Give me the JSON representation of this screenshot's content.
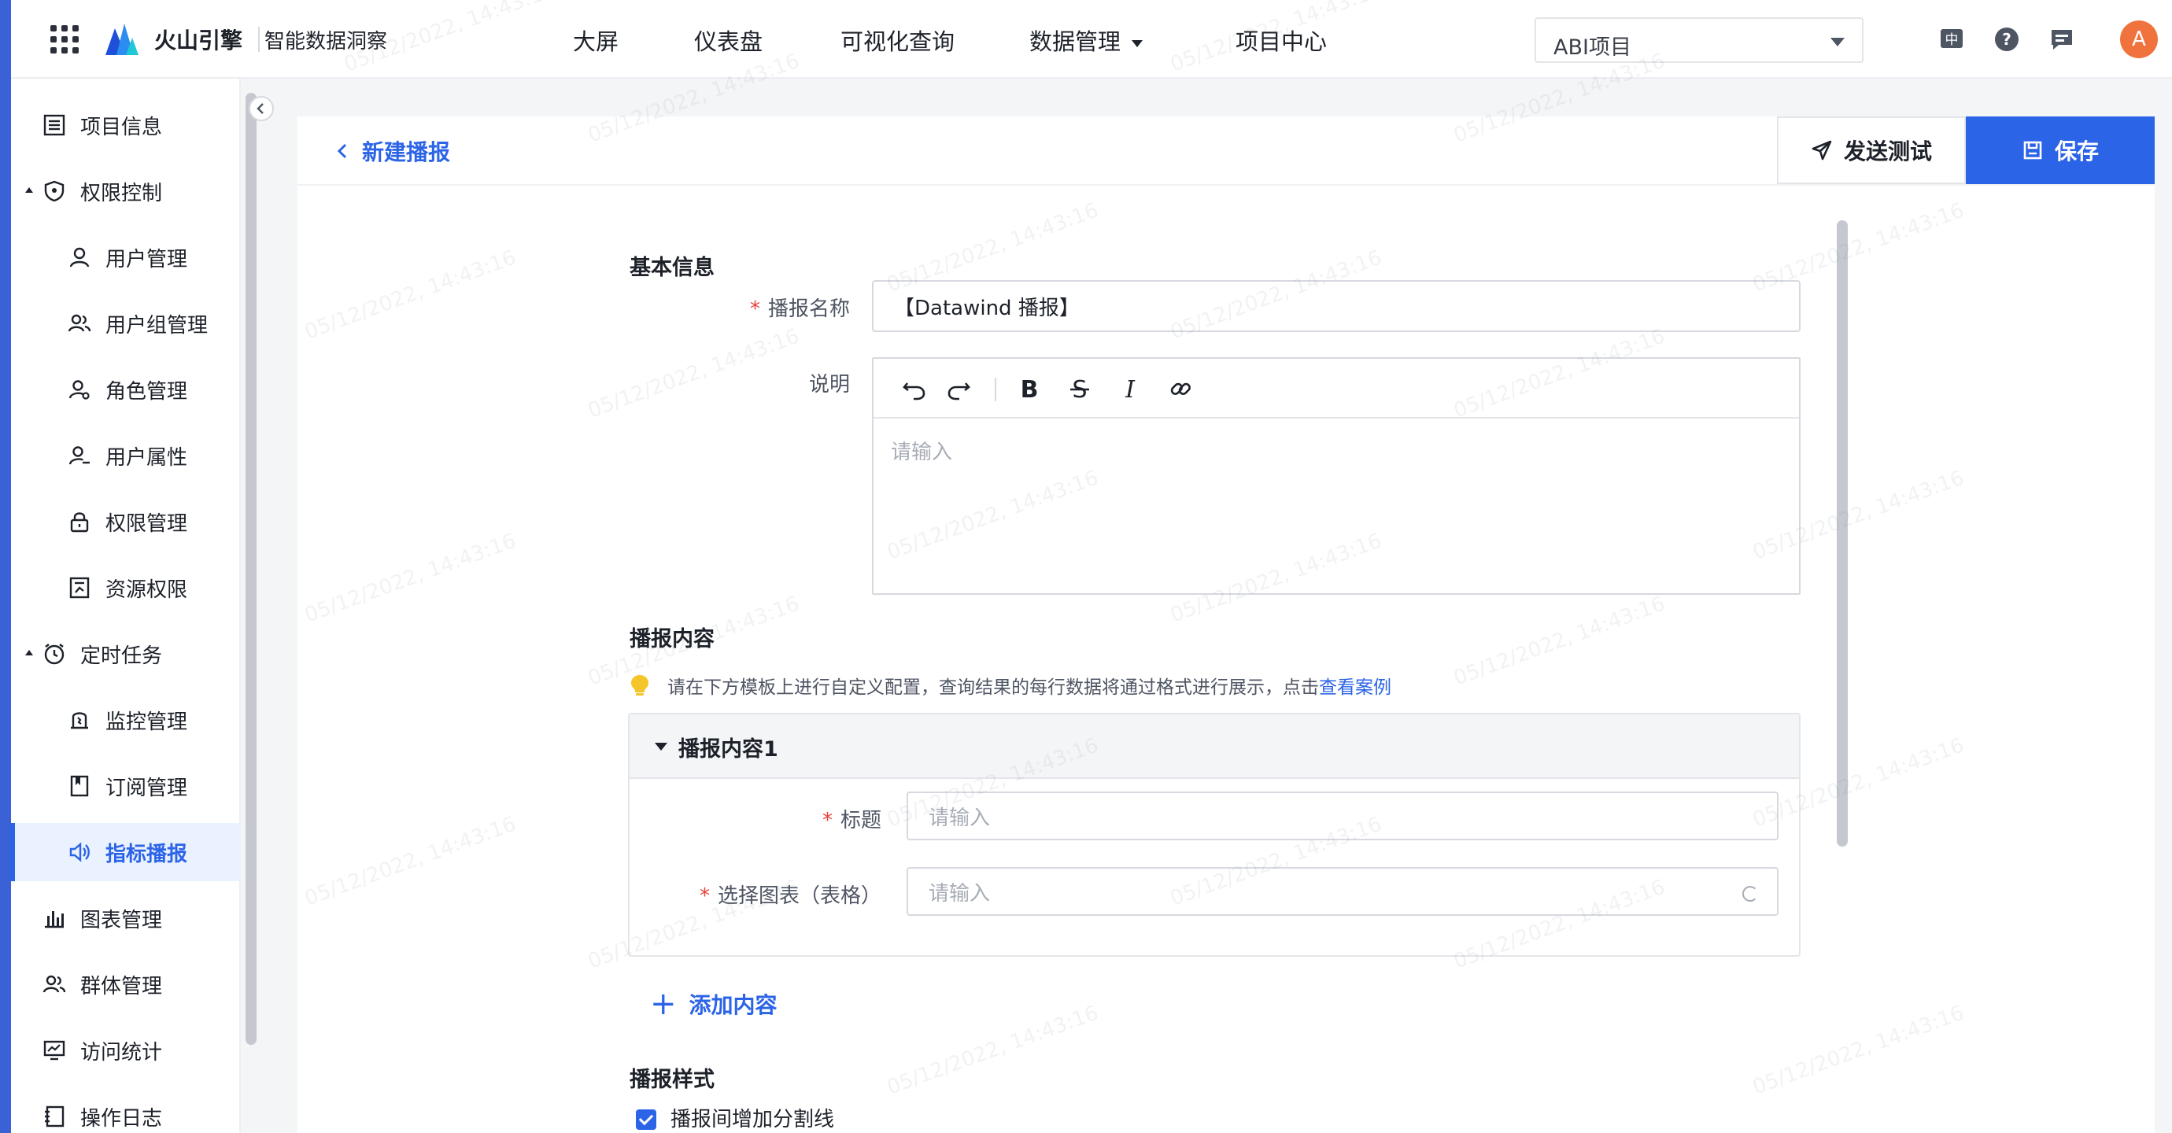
{
  "header": {
    "brand": "火山引擎",
    "product": "智能数据洞察",
    "nav": [
      {
        "label": "大屏"
      },
      {
        "label": "仪表盘"
      },
      {
        "label": "可视化查询"
      },
      {
        "label": "数据管理"
      },
      {
        "label": "项目中心"
      }
    ],
    "project_select": "ABI项目",
    "avatar_letter": "A"
  },
  "sidebar": {
    "items": [
      {
        "label": "项目信息",
        "icon": "list-icon"
      },
      {
        "label": "权限控制",
        "icon": "shield-icon"
      },
      {
        "label": "用户管理",
        "icon": "user-icon"
      },
      {
        "label": "用户组管理",
        "icon": "users-icon"
      },
      {
        "label": "角色管理",
        "icon": "role-icon"
      },
      {
        "label": "用户属性",
        "icon": "user-attr-icon"
      },
      {
        "label": "权限管理",
        "icon": "lock-icon"
      },
      {
        "label": "资源权限",
        "icon": "resource-icon"
      },
      {
        "label": "定时任务",
        "icon": "clock-icon"
      },
      {
        "label": "监控管理",
        "icon": "monitor-icon"
      },
      {
        "label": "订阅管理",
        "icon": "bookmark-icon"
      },
      {
        "label": "指标播报",
        "icon": "speaker-icon"
      },
      {
        "label": "图表管理",
        "icon": "bar-chart-icon"
      },
      {
        "label": "群体管理",
        "icon": "group-icon"
      },
      {
        "label": "访问统计",
        "icon": "stats-icon"
      },
      {
        "label": "操作日志",
        "icon": "log-icon"
      }
    ]
  },
  "page": {
    "back_label": "新建播报",
    "send_test": "发送测试",
    "save": "保存"
  },
  "form": {
    "basic_info": "基本信息",
    "name_label": "播报名称",
    "name_value": "【Datawind 播报】",
    "desc_label": "说明",
    "desc_placeholder": "请输入",
    "content_title": "播报内容",
    "tip_text": "请在下方模板上进行自定义配置，查询结果的每行数据将通过格式进行展示，点击",
    "tip_link": "查看案例",
    "panel_title": "播报内容1",
    "title_label": "标题",
    "title_placeholder": "请输入",
    "chart_label": "选择图表（表格）",
    "chart_placeholder": "请输入",
    "add_content": "添加内容",
    "style_title": "播报样式",
    "divider_label": "播报间增加分割线"
  },
  "watermark": "05/12/2022, 14:43:16",
  "colors": {
    "accent": "#2c64e8",
    "required": "#e8413c",
    "avatar": "#f0723c"
  }
}
